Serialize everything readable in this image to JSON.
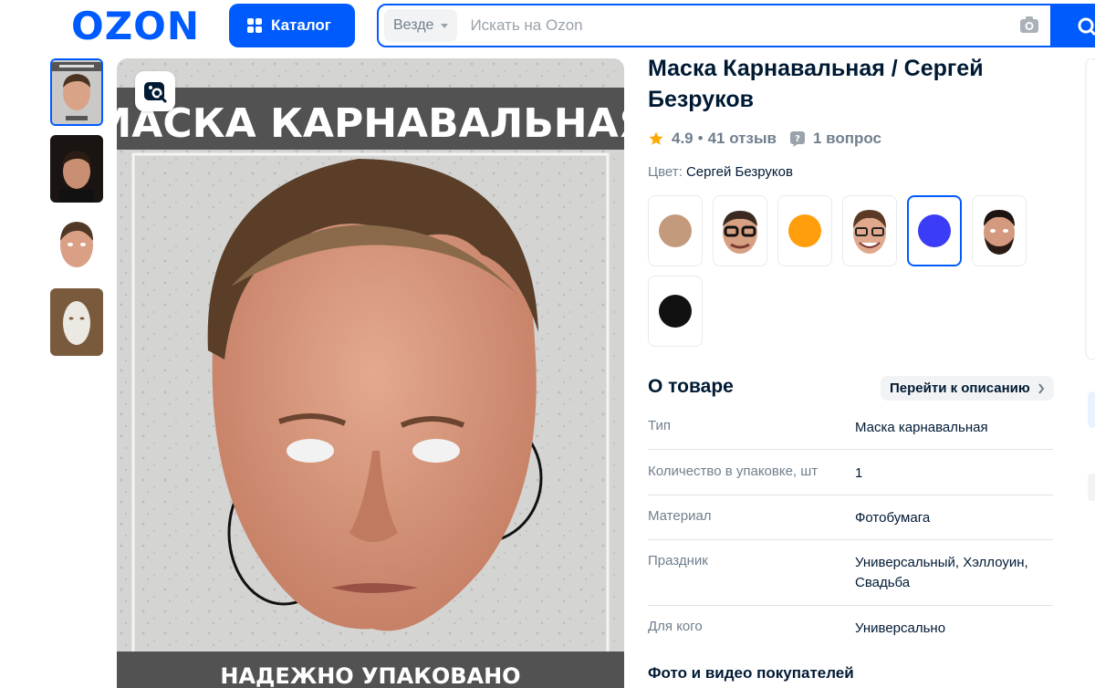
{
  "header": {
    "logo": "OZON",
    "catalog_label": "Каталог",
    "search_scope": "Везде",
    "search_placeholder": "Искать на Ozon"
  },
  "product": {
    "title": "Маска Карнавальная / Сергей Безруков",
    "rating": "4.9",
    "reviews": "41 отзыв",
    "questions": "1 вопрос",
    "color_label": "Цвет:",
    "color_value": "Сергей Безруков",
    "image_banner_top": "МАСКА КАРНАВАЛЬНАЯ",
    "image_banner_bottom": "НАДЕЖНО УПАКОВАНО",
    "thumbnail_caption": "МАСКА КАРНАВАЛЬНАЯ"
  },
  "swatches": [
    {
      "kind": "color",
      "color": "#c49a7c"
    },
    {
      "kind": "face",
      "icon": "face-glasses-icon"
    },
    {
      "kind": "color",
      "color": "#ff9e0a"
    },
    {
      "kind": "face",
      "icon": "face-glasses-smile-icon"
    },
    {
      "kind": "color",
      "color": "#3b3cf5",
      "selected": true
    },
    {
      "kind": "face",
      "icon": "face-beard-icon"
    },
    {
      "kind": "color",
      "color": "#111111"
    }
  ],
  "about": {
    "title": "О товаре",
    "goto_label": "Перейти к описанию",
    "specs": [
      {
        "key": "Тип",
        "value": "Маска карнавальная"
      },
      {
        "key": "Количество в упаковке, шт",
        "value": "1"
      },
      {
        "key": "Материал",
        "value": "Фотобумага"
      },
      {
        "key": "Праздник",
        "value": "Универсальный, Хэллоуин, Свадьба"
      },
      {
        "key": "Для кого",
        "value": "Универсально"
      }
    ]
  },
  "reviews_section": {
    "title": "Фото и видео покупателей"
  },
  "colors": {
    "brand": "#005bff",
    "star": "#ffa800",
    "text": "#001a34",
    "muted": "#707f8d"
  }
}
